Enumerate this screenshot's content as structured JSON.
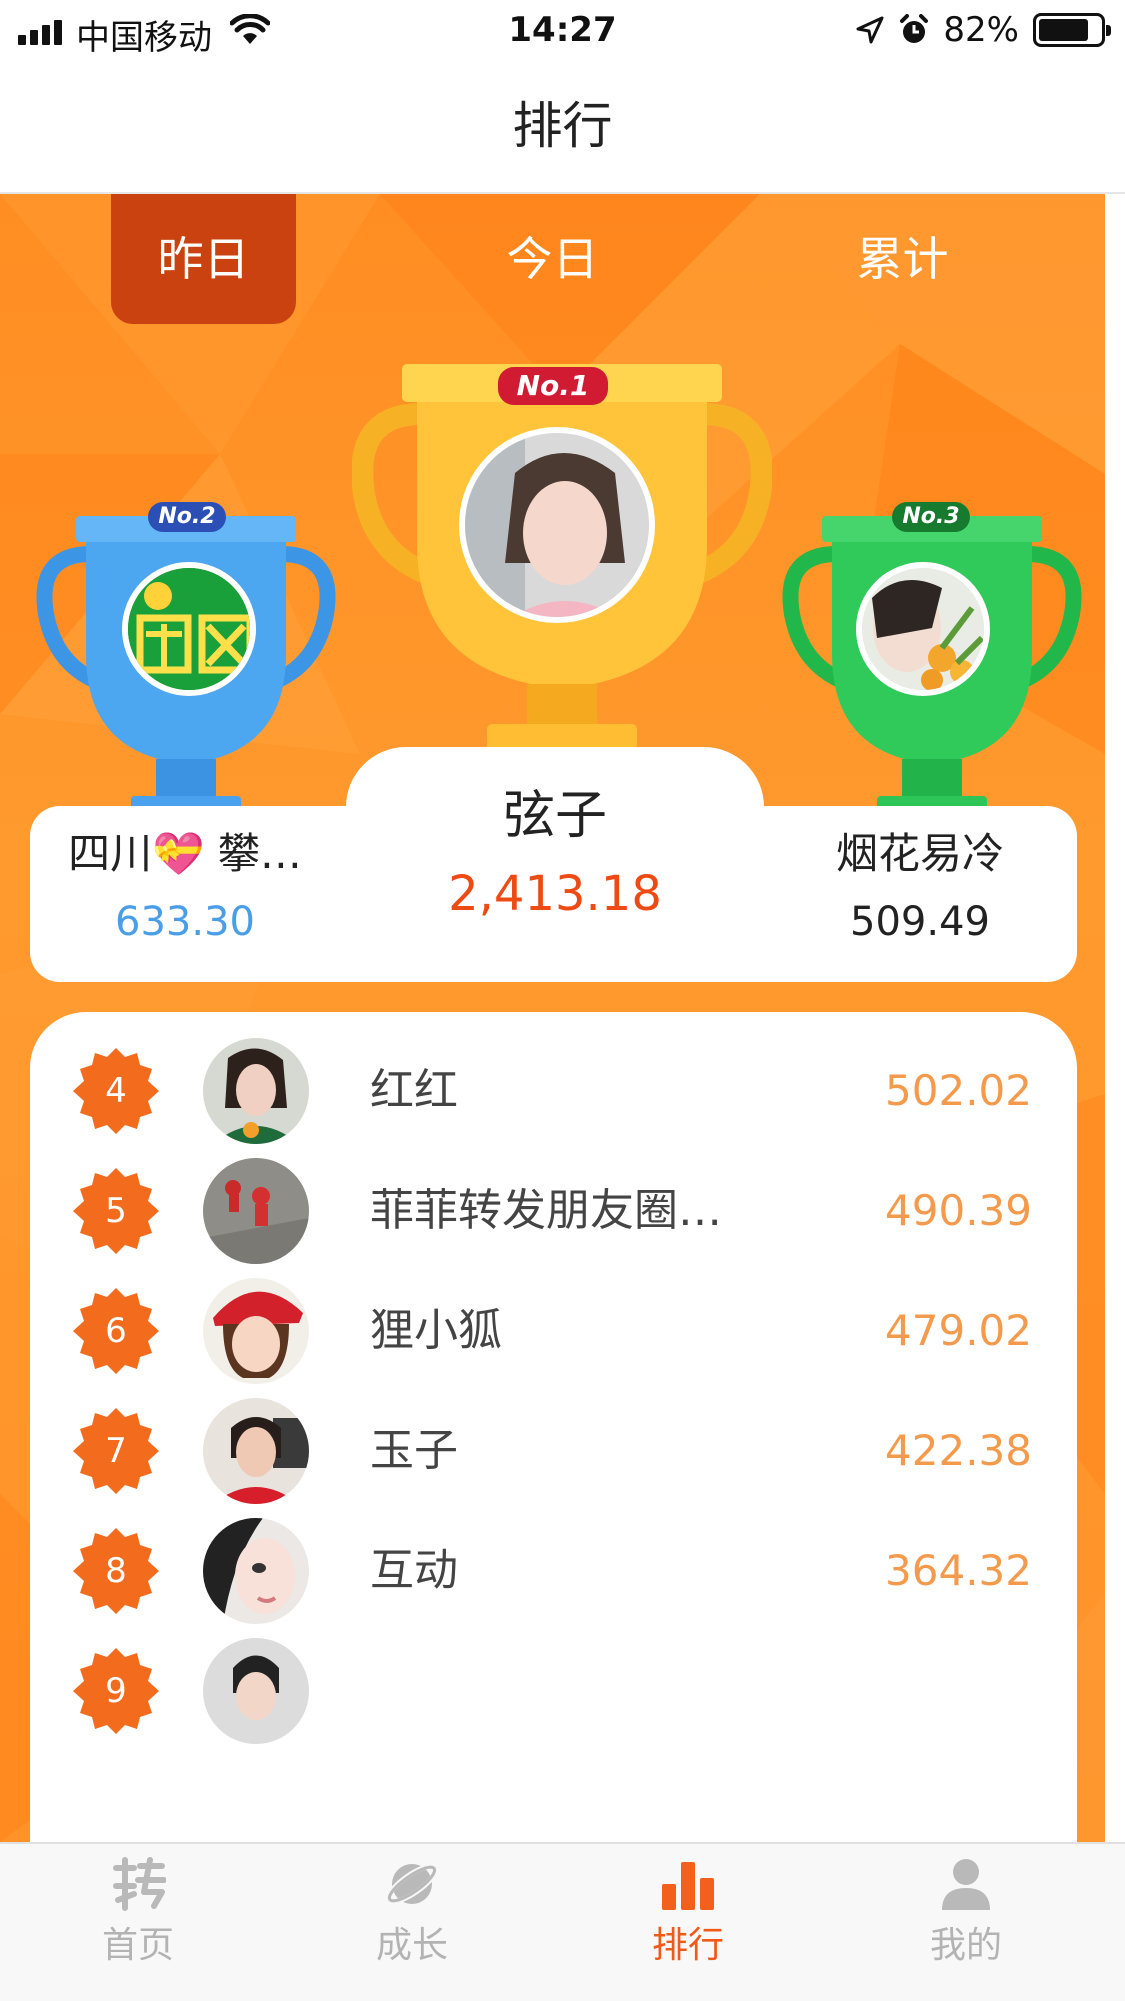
{
  "status_bar": {
    "carrier": "中国移动",
    "time": "14:27",
    "battery_percent": "82%",
    "battery_level": 0.82,
    "icons": [
      "signal-icon",
      "wifi-icon",
      "location-arrow-icon",
      "alarm-icon",
      "battery-icon"
    ]
  },
  "nav": {
    "title": "排行"
  },
  "period_tabs": {
    "selected": "昨日",
    "items": [
      {
        "label": "昨日"
      },
      {
        "label": "今日"
      },
      {
        "label": "累计"
      }
    ]
  },
  "podium": {
    "first": {
      "badge": "No.1",
      "name": "弦子",
      "score": "2,413.18"
    },
    "second": {
      "badge": "No.2",
      "name": "四川💝 攀…",
      "score": "633.30"
    },
    "third": {
      "badge": "No.3",
      "name": "烟花易冷",
      "score": "509.49"
    }
  },
  "ranking": [
    {
      "rank": "4",
      "name": "红红",
      "score": "502.02"
    },
    {
      "rank": "5",
      "name": "菲菲转发朋友圈…",
      "score": "490.39"
    },
    {
      "rank": "6",
      "name": "狸小狐",
      "score": "479.02"
    },
    {
      "rank": "7",
      "name": "玉子",
      "score": "422.38"
    },
    {
      "rank": "8",
      "name": "互动",
      "score": "364.32"
    },
    {
      "rank": "9",
      "name": "",
      "score": ""
    }
  ],
  "bottom_tabs": [
    {
      "label": "首页",
      "icon": "zhuan-icon",
      "active": false
    },
    {
      "label": "成长",
      "icon": "planet-icon",
      "active": false
    },
    {
      "label": "排行",
      "icon": "bar-chart-icon",
      "active": true
    },
    {
      "label": "我的",
      "icon": "user-icon",
      "active": false
    }
  ],
  "colors": {
    "accent": "#ef5a19",
    "background_orange": "#ff8d22",
    "active_tab": "#c9420f",
    "second_score": "#4a9ee8",
    "first_score": "#ee4a14",
    "rank_score": "#f49a4c",
    "trophy_gold": "#ffc43a",
    "trophy_blue": "#4da6f0",
    "trophy_green": "#2fca5a"
  }
}
